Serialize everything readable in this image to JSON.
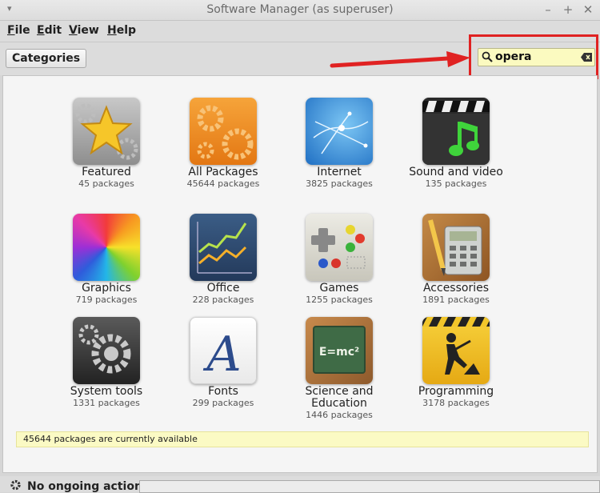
{
  "window": {
    "title": "Software Manager (as superuser)",
    "menu_arrow": "▾",
    "minimize": "–",
    "maximize": "+",
    "close": "✕"
  },
  "menubar": {
    "items": [
      {
        "accel": "F",
        "rest": "ile"
      },
      {
        "accel": "E",
        "rest": "dit"
      },
      {
        "accel": "V",
        "rest": "iew"
      },
      {
        "accel": "H",
        "rest": "elp"
      }
    ]
  },
  "toolbar": {
    "categories_label": "Categories",
    "search_value": "opera"
  },
  "categories": [
    {
      "name": "Featured",
      "count": "45 packages",
      "icon": "star-icon"
    },
    {
      "name": "All Packages",
      "count": "45644 packages",
      "icon": "gears-icon"
    },
    {
      "name": "Internet",
      "count": "3825 packages",
      "icon": "globe-network-icon"
    },
    {
      "name": "Sound and video",
      "count": "135 packages",
      "icon": "clapper-music-icon"
    },
    {
      "name": "Graphics",
      "count": "719 packages",
      "icon": "color-wheel-icon"
    },
    {
      "name": "Office",
      "count": "228 packages",
      "icon": "line-chart-icon"
    },
    {
      "name": "Games",
      "count": "1255 packages",
      "icon": "gamepad-icon"
    },
    {
      "name": "Accessories",
      "count": "1891 packages",
      "icon": "calculator-icon"
    },
    {
      "name": "System tools",
      "count": "1331 packages",
      "icon": "system-gears-icon"
    },
    {
      "name": "Fonts",
      "count": "299 packages",
      "icon": "font-letter-icon"
    },
    {
      "name": "Science and Education",
      "count": "1446 packages",
      "icon": "chalkboard-icon"
    },
    {
      "name": "Programming",
      "count": "3178 packages",
      "icon": "construction-sign-icon"
    }
  ],
  "status": {
    "available": "45644 packages are currently available",
    "actions": "No ongoing actions"
  },
  "colors": {
    "highlight": "#e02222",
    "search_bg": "#fbfac0"
  }
}
